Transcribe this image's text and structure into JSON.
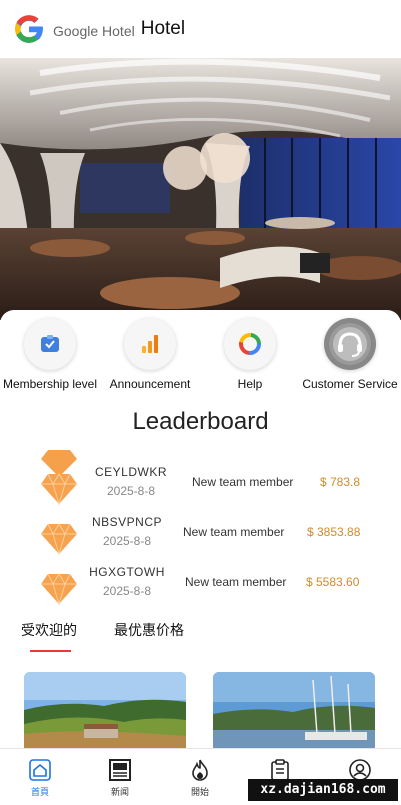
{
  "header": {
    "logo_label": "Google Hotel",
    "title": "Hotel"
  },
  "actions": [
    {
      "label": "Membership level",
      "icon": "membership-tag-icon"
    },
    {
      "label": "Announcement",
      "icon": "bar-chart-icon"
    },
    {
      "label": "Help",
      "icon": "google-o-icon"
    },
    {
      "label": "Customer Service",
      "icon": "headset-icon"
    }
  ],
  "leaderboard": {
    "title": "Leaderboard",
    "rows": [
      {
        "name": "CEYLDWKR",
        "date": "2025-8-8",
        "desc": "New team member",
        "amount": "$ 783.8"
      },
      {
        "name": "NBSVPNCP",
        "date": "2025-8-8",
        "desc": "New team member",
        "amount": "$ 3853.88"
      },
      {
        "name": "HGXGTOWH",
        "date": "2025-8-8",
        "desc": "New team member",
        "amount": "$ 5583.60"
      }
    ]
  },
  "tabs": [
    {
      "label": "受欢迎的",
      "active": true
    },
    {
      "label": "最优惠价格",
      "active": false
    }
  ],
  "nav": [
    {
      "label": "首頁",
      "icon": "home-icon",
      "active": true
    },
    {
      "label": "新闻",
      "icon": "news-icon",
      "active": false
    },
    {
      "label": "開始",
      "icon": "flame-icon",
      "active": false
    },
    {
      "label": "",
      "icon": "clipboard-icon",
      "active": false
    },
    {
      "label": "",
      "icon": "profile-icon",
      "active": false
    }
  ],
  "watermark": "xz.dajian168.com",
  "colors": {
    "accent": "#1a73e8",
    "tab_underline": "#e63b3b",
    "amount": "#d18a2c",
    "gem": "#f5a04a"
  }
}
